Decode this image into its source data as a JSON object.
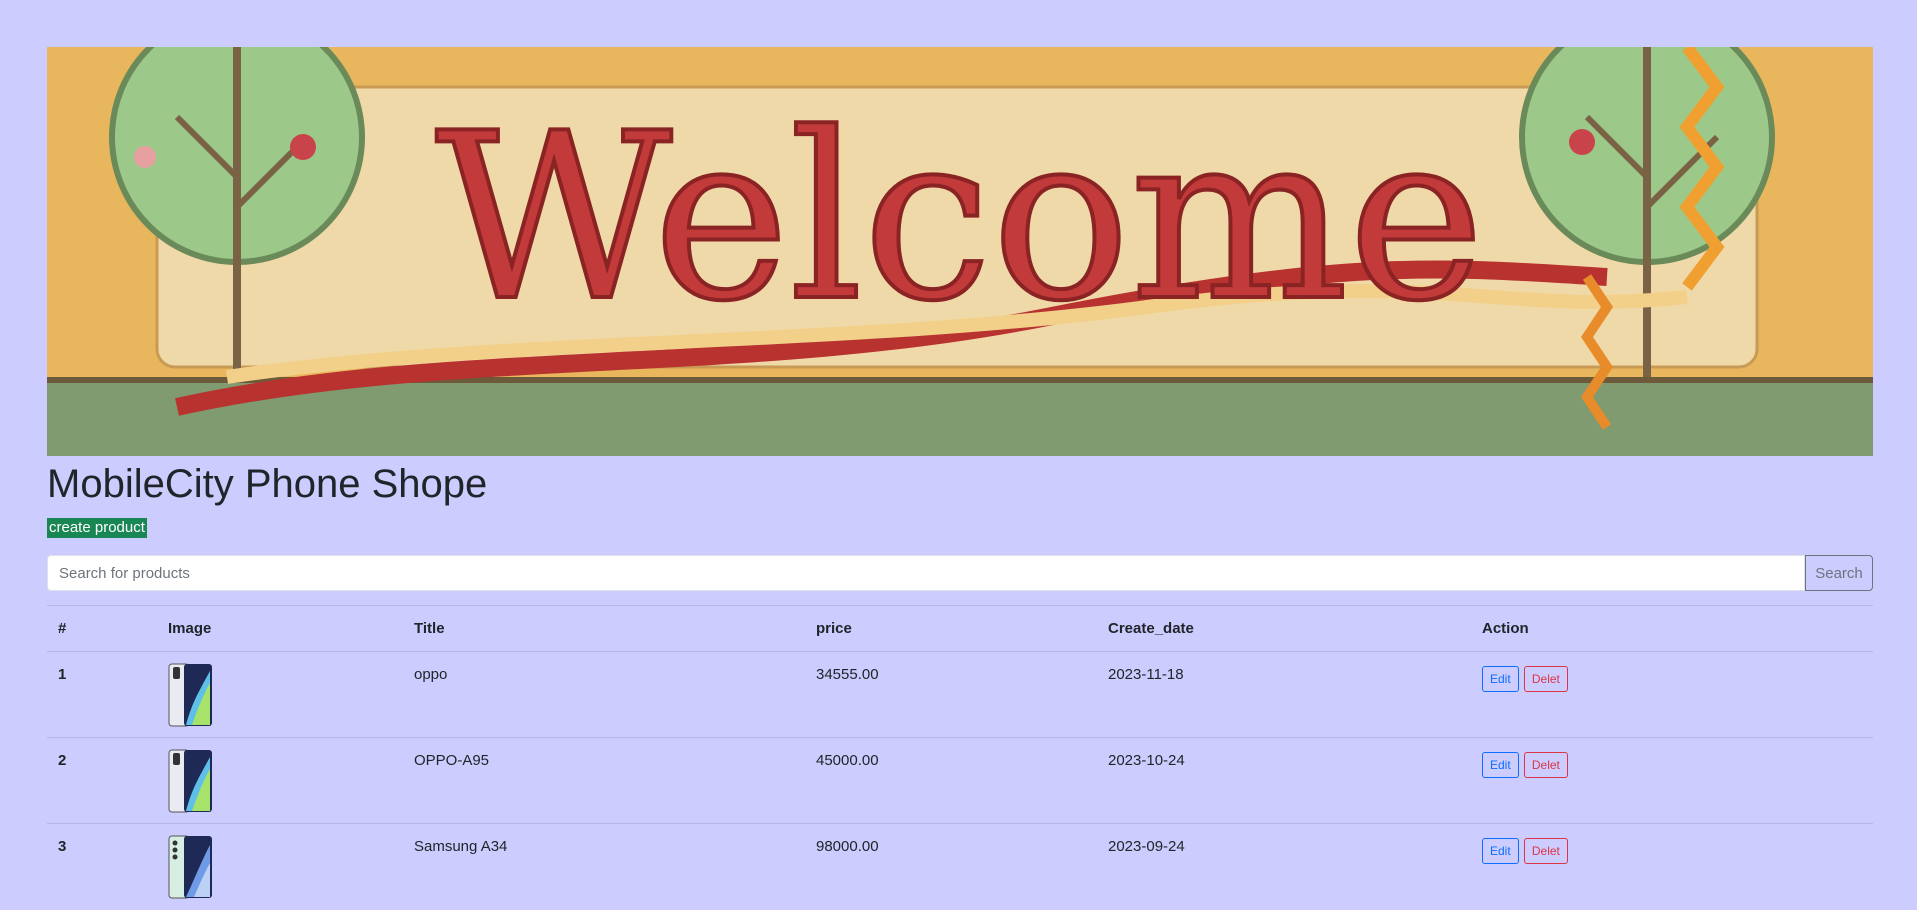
{
  "banner": {
    "text": "Welcome"
  },
  "shop": {
    "title": "MobileCity Phone Shope",
    "create_label": "create product"
  },
  "search": {
    "placeholder": "Search for products",
    "button_label": "Search"
  },
  "table": {
    "headers": [
      "#",
      "Image",
      "Title",
      "price",
      "Create_date",
      "Action"
    ],
    "rows": [
      {
        "num": "1",
        "title": "oppo",
        "price": "34555.00",
        "date": "2023-11-18",
        "edit": "Edit",
        "delete": "Delet"
      },
      {
        "num": "2",
        "title": "OPPO-A95",
        "price": "45000.00",
        "date": "2023-10-24",
        "edit": "Edit",
        "delete": "Delet"
      },
      {
        "num": "3",
        "title": "Samsung A34",
        "price": "98000.00",
        "date": "2023-09-24",
        "edit": "Edit",
        "delete": "Delet"
      }
    ]
  }
}
